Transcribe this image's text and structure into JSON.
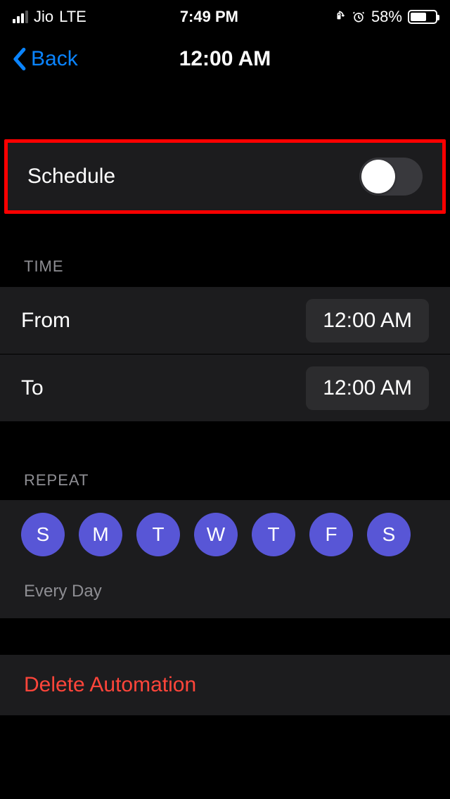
{
  "status": {
    "carrier": "Jio",
    "network": "LTE",
    "time": "7:49 PM",
    "battery_pct": "58%"
  },
  "nav": {
    "back_label": "Back",
    "title": "12:00 AM"
  },
  "schedule_row": {
    "label": "Schedule",
    "enabled": false
  },
  "time_section": {
    "header": "TIME",
    "from_label": "From",
    "from_value": "12:00 AM",
    "to_label": "To",
    "to_value": "12:00 AM"
  },
  "repeat_section": {
    "header": "REPEAT",
    "days": [
      "S",
      "M",
      "T",
      "W",
      "T",
      "F",
      "S"
    ],
    "summary": "Every Day"
  },
  "delete_label": "Delete Automation",
  "colors": {
    "accent_blue": "#0a84ff",
    "day_purple": "#5856d6",
    "destructive_red": "#ff453a",
    "row_bg": "#1c1c1e",
    "pill_bg": "#2c2c2e",
    "secondary_text": "#8e8e93"
  }
}
